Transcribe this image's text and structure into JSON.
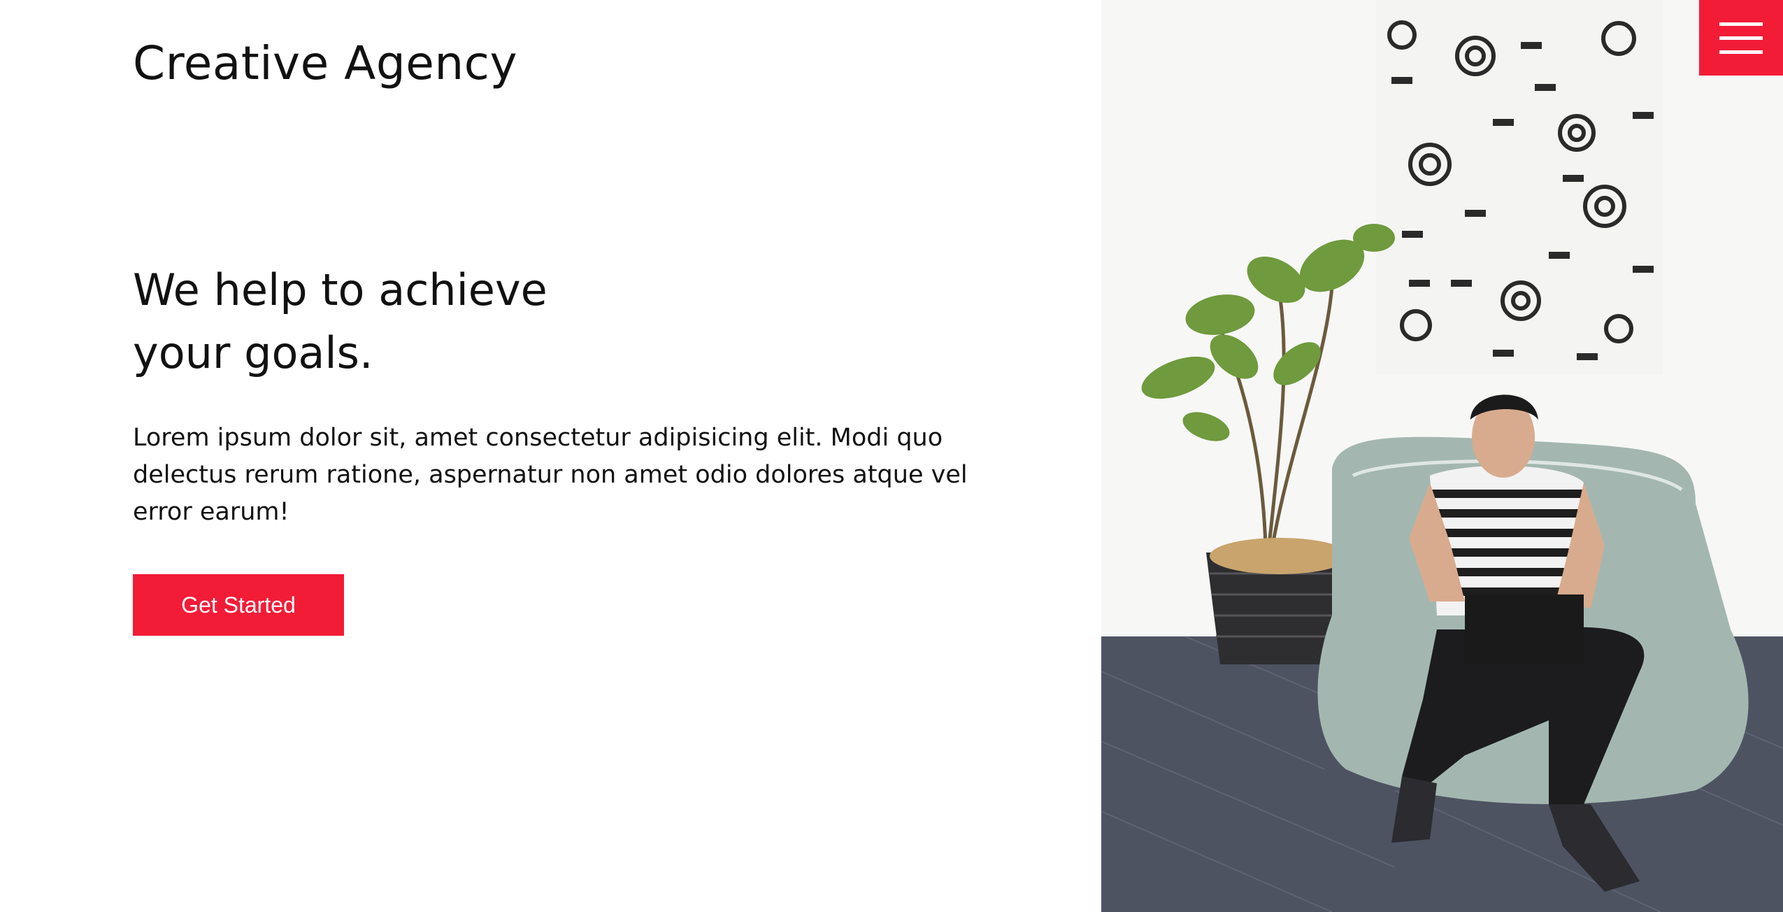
{
  "brand": {
    "name": "Creative Agency"
  },
  "hero": {
    "headline_line1": "We help to achieve",
    "headline_line2": "your goals.",
    "description": "Lorem ipsum dolor sit, amet consectetur adipisicing elit. Modi quo delectus rerum ratione, aspernatur non amet odio dolores atque vel error earum!",
    "cta_label": "Get Started"
  },
  "menu": {
    "icon": "hamburger-menu-icon"
  },
  "colors": {
    "accent": "#f21c37",
    "text": "#111111",
    "background": "#ffffff"
  }
}
